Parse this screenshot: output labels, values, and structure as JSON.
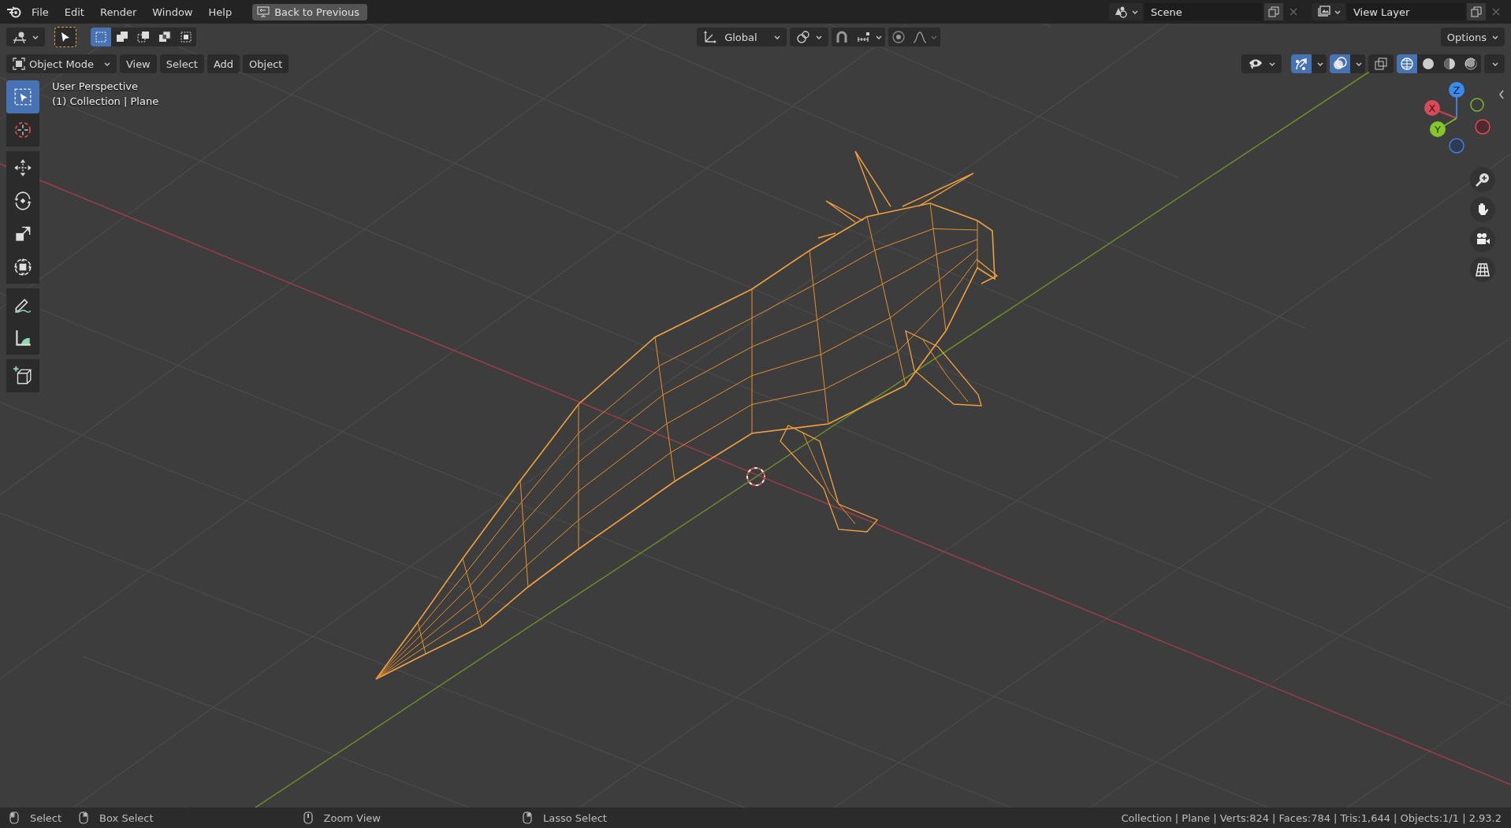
{
  "menubar": {
    "items": [
      "File",
      "Edit",
      "Render",
      "Window",
      "Help"
    ],
    "back_button": "Back to Previous"
  },
  "scene": {
    "value": "Scene"
  },
  "view_layer": {
    "value": "View Layer"
  },
  "tool_header": {
    "select_modes": [
      {
        "selected": true
      },
      {
        "selected": false
      },
      {
        "selected": false
      },
      {
        "selected": false
      },
      {
        "selected": false
      }
    ],
    "orientation": "Global",
    "options": "Options"
  },
  "view_header": {
    "mode": "Object Mode",
    "menus": [
      "View",
      "Select",
      "Add",
      "Object"
    ],
    "gizmo_toggle": {
      "on": true
    },
    "overlay_toggle": {
      "on": true
    },
    "xray_toggle": {
      "on": false
    },
    "shading": [
      {
        "selected": true
      },
      {
        "selected": false
      },
      {
        "selected": false
      },
      {
        "selected": false
      }
    ]
  },
  "viewport": {
    "view_name": "User Perspective",
    "collection_info": "(1) Collection | Plane"
  },
  "tools": [
    {
      "selected": true
    },
    {
      "selected": false
    },
    {
      "selected": false
    },
    {
      "selected": false
    },
    {
      "selected": false
    },
    {
      "selected": false
    },
    {
      "selected": false
    },
    {
      "selected": false
    },
    {
      "selected": false
    }
  ],
  "gizmo": {
    "axes": [
      "X",
      "Y",
      "Z"
    ]
  },
  "status_bar": {
    "hints": [
      "Select",
      "Box Select",
      "Zoom View",
      "Lasso Select"
    ],
    "stats": "Collection | Plane | Verts:824 | Faces:784 | Tris:1,644 | Objects:1/1 | 2.93.2"
  }
}
